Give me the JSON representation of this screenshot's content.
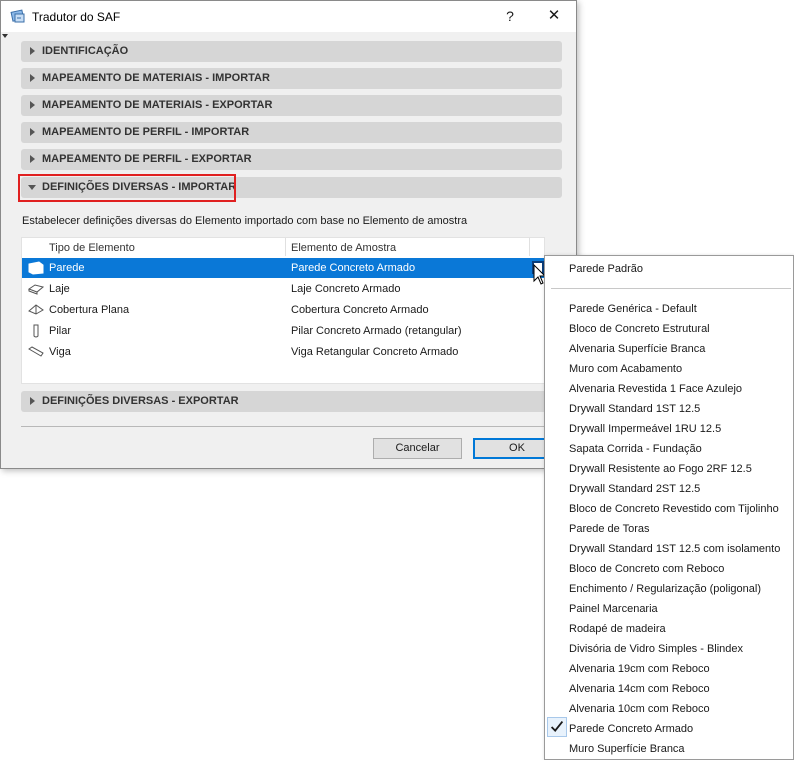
{
  "window": {
    "title": "Tradutor do SAF",
    "help_glyph": "?",
    "close_glyph": "✕"
  },
  "sections": [
    {
      "label": "IDENTIFICAÇÃO",
      "expanded": false
    },
    {
      "label": "MAPEAMENTO DE MATERIAIS - IMPORTAR",
      "expanded": false
    },
    {
      "label": "MAPEAMENTO DE MATERIAIS - EXPORTAR",
      "expanded": false
    },
    {
      "label": "MAPEAMENTO DE PERFIL - IMPORTAR",
      "expanded": false
    },
    {
      "label": "MAPEAMENTO DE PERFIL - EXPORTAR",
      "expanded": false
    },
    {
      "label": "DEFINIÇÕES DIVERSAS - IMPORTAR",
      "expanded": true
    },
    {
      "label": "DEFINIÇÕES DIVERSAS - EXPORTAR",
      "expanded": false
    }
  ],
  "description": "Estabelecer definições diversas do Elemento importado com base no Elemento de amostra",
  "table": {
    "headers": [
      "Tipo de Elemento",
      "Elemento de Amostra"
    ],
    "rows": [
      {
        "type": "Parede",
        "sample": "Parede Concreto Armado",
        "icon": "wall-icon",
        "selected": true
      },
      {
        "type": "Laje",
        "sample": "Laje Concreto Armado",
        "icon": "slab-icon",
        "selected": false
      },
      {
        "type": "Cobertura Plana",
        "sample": "Cobertura Concreto Armado",
        "icon": "roof-icon",
        "selected": false
      },
      {
        "type": "Pilar",
        "sample": "Pilar Concreto Armado (retangular)",
        "icon": "column-icon",
        "selected": false
      },
      {
        "type": "Viga",
        "sample": "Viga Retangular Concreto Armado",
        "icon": "beam-icon",
        "selected": false
      }
    ]
  },
  "buttons": {
    "cancel": "Cancelar",
    "ok": "OK"
  },
  "dropdown": {
    "top_item": "Parede Padrão",
    "items": [
      " Parede Genérica - Default",
      "Bloco de Concreto Estrutural",
      "Alvenaria Superfície Branca",
      "Muro com Acabamento",
      "Alvenaria Revestida 1 Face Azulejo",
      "Drywall Standard 1ST 12.5",
      "Drywall Impermeável 1RU 12.5",
      "Sapata Corrida - Fundação",
      "Drywall Resistente ao Fogo 2RF 12.5",
      "Drywall Standard 2ST 12.5",
      "Bloco de Concreto Revestido com Tijolinho",
      "Parede de Toras",
      "Drywall Standard 1ST 12.5 com isolamento",
      "Bloco de Concreto com Reboco",
      "Enchimento / Regularização (poligonal)",
      "Painel Marcenaria",
      "Rodapé de madeira",
      "Divisória de Vidro Simples - Blindex",
      "Alvenaria 19cm com Reboco",
      "Alvenaria 14cm com Reboco",
      "Alvenaria 10cm com Reboco",
      "Parede Concreto Armado",
      "Muro Superfície Branca"
    ],
    "checked_item": "Parede Concreto Armado"
  },
  "colors": {
    "selection": "#0a78d7",
    "highlight_border": "#e02020"
  }
}
